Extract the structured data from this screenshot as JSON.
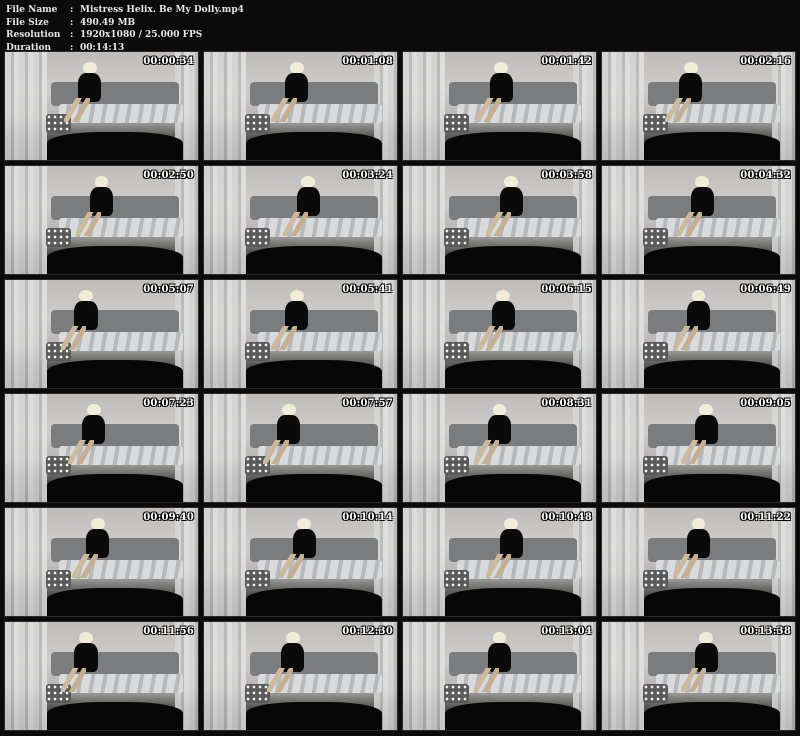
{
  "file_info": {
    "name_label": "File Name",
    "name_value": "Mistress Helix. Be My Dolly.mp4",
    "size_label": "File Size",
    "size_value": "490.49 MB",
    "resolution_label": "Resolution",
    "resolution_value": "1920x1080 / 25.000 FPS",
    "duration_label": "Duration",
    "duration_value": "00:14:13",
    "separator": ":"
  },
  "thumbnails": [
    {
      "timestamp": "00:00:34"
    },
    {
      "timestamp": "00:01:08"
    },
    {
      "timestamp": "00:01:42"
    },
    {
      "timestamp": "00:02:16"
    },
    {
      "timestamp": "00:02:50"
    },
    {
      "timestamp": "00:03:24"
    },
    {
      "timestamp": "00:03:58"
    },
    {
      "timestamp": "00:04:32"
    },
    {
      "timestamp": "00:05:07"
    },
    {
      "timestamp": "00:05:41"
    },
    {
      "timestamp": "00:06:15"
    },
    {
      "timestamp": "00:06:49"
    },
    {
      "timestamp": "00:07:23"
    },
    {
      "timestamp": "00:07:57"
    },
    {
      "timestamp": "00:08:31"
    },
    {
      "timestamp": "00:09:05"
    },
    {
      "timestamp": "00:09:40"
    },
    {
      "timestamp": "00:10:14"
    },
    {
      "timestamp": "00:10:48"
    },
    {
      "timestamp": "00:11:22"
    },
    {
      "timestamp": "00:11:56"
    },
    {
      "timestamp": "00:12:30"
    },
    {
      "timestamp": "00:13:04"
    },
    {
      "timestamp": "00:13:38"
    }
  ],
  "colors": {
    "background": "#0b0b0b",
    "header_text": "#e6e6e6",
    "timestamp_text": "#ffffff"
  }
}
